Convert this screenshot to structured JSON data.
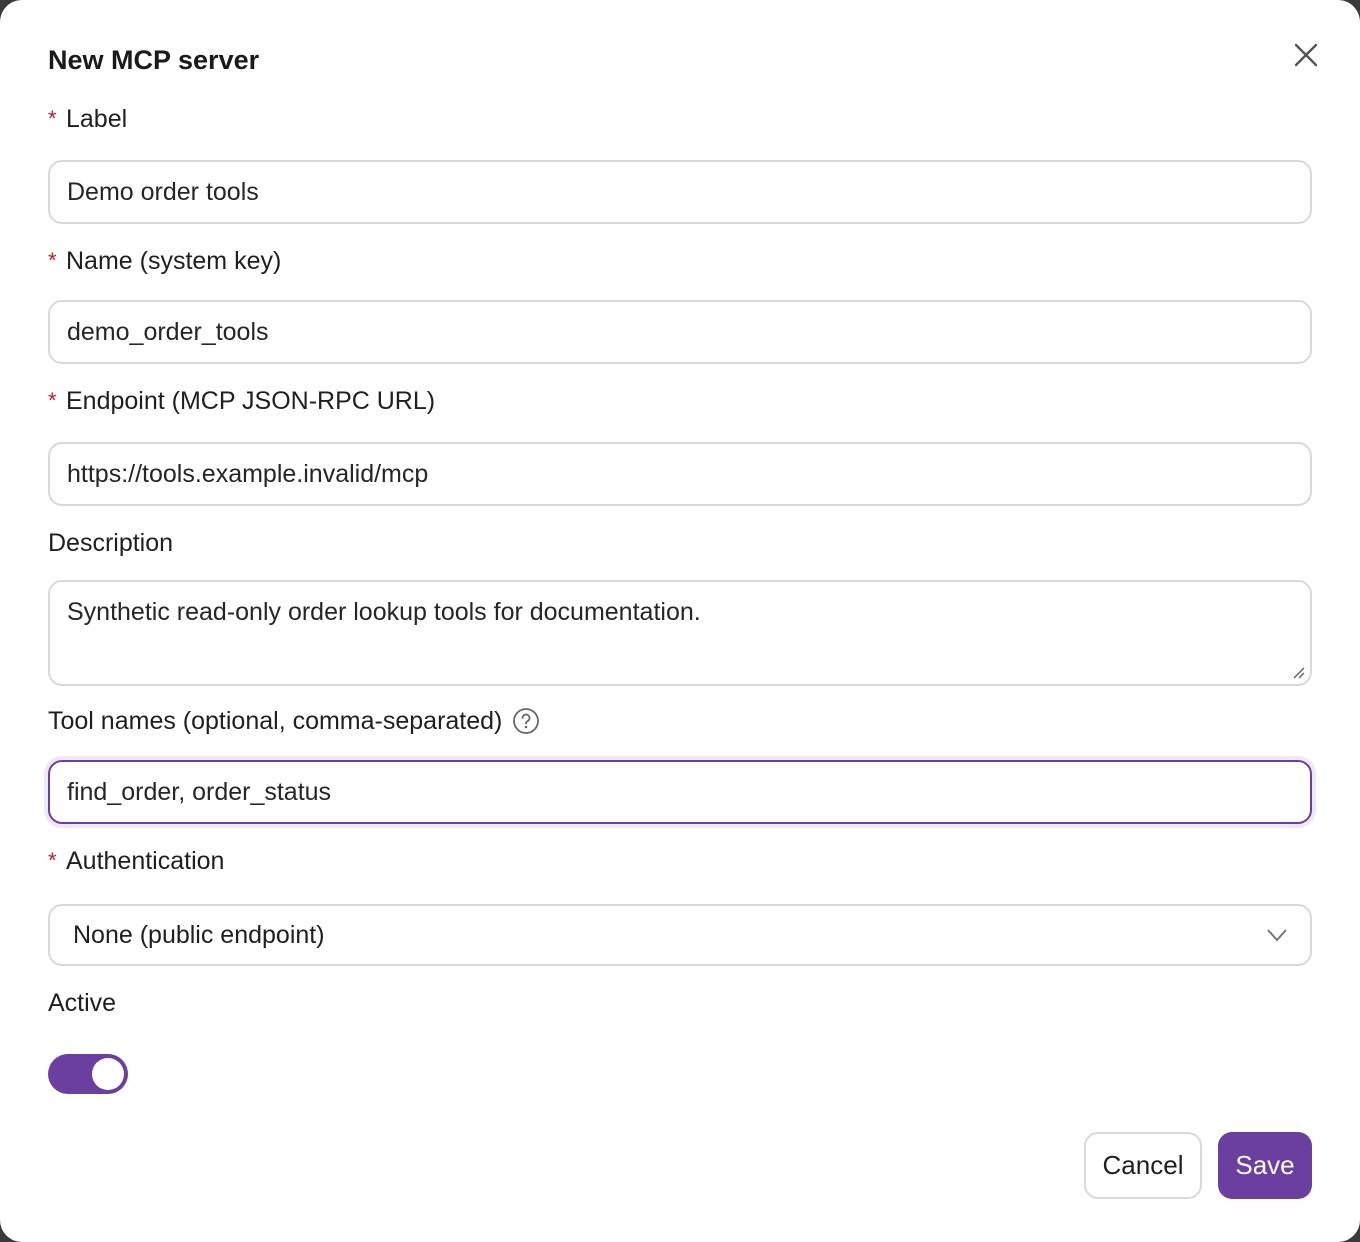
{
  "dialog": {
    "title": "New MCP server",
    "close_icon": "close-icon"
  },
  "form": {
    "required_marker": "*",
    "label": {
      "label": "Label",
      "value": "Demo order tools"
    },
    "name": {
      "label": "Name (system key)",
      "value": "demo_order_tools"
    },
    "endpoint": {
      "label": "Endpoint (MCP JSON-RPC URL)",
      "value": "https://tools.example.invalid/mcp"
    },
    "description": {
      "label": "Description",
      "value": "Synthetic read-only order lookup tools for documentation."
    },
    "tool_names": {
      "label": "Tool names (optional, comma-separated)",
      "value": "find_order, order_status",
      "help_icon": "question-circle-icon"
    },
    "authentication": {
      "label": "Authentication",
      "selected": "None (public endpoint)",
      "icon": "chevron-down-icon"
    },
    "active": {
      "label": "Active",
      "on": true
    }
  },
  "actions": {
    "cancel_label": "Cancel",
    "save_label": "Save"
  },
  "colors": {
    "accent": "#6b3fa0",
    "required": "#c0172c",
    "border": "#d9d9d9"
  }
}
